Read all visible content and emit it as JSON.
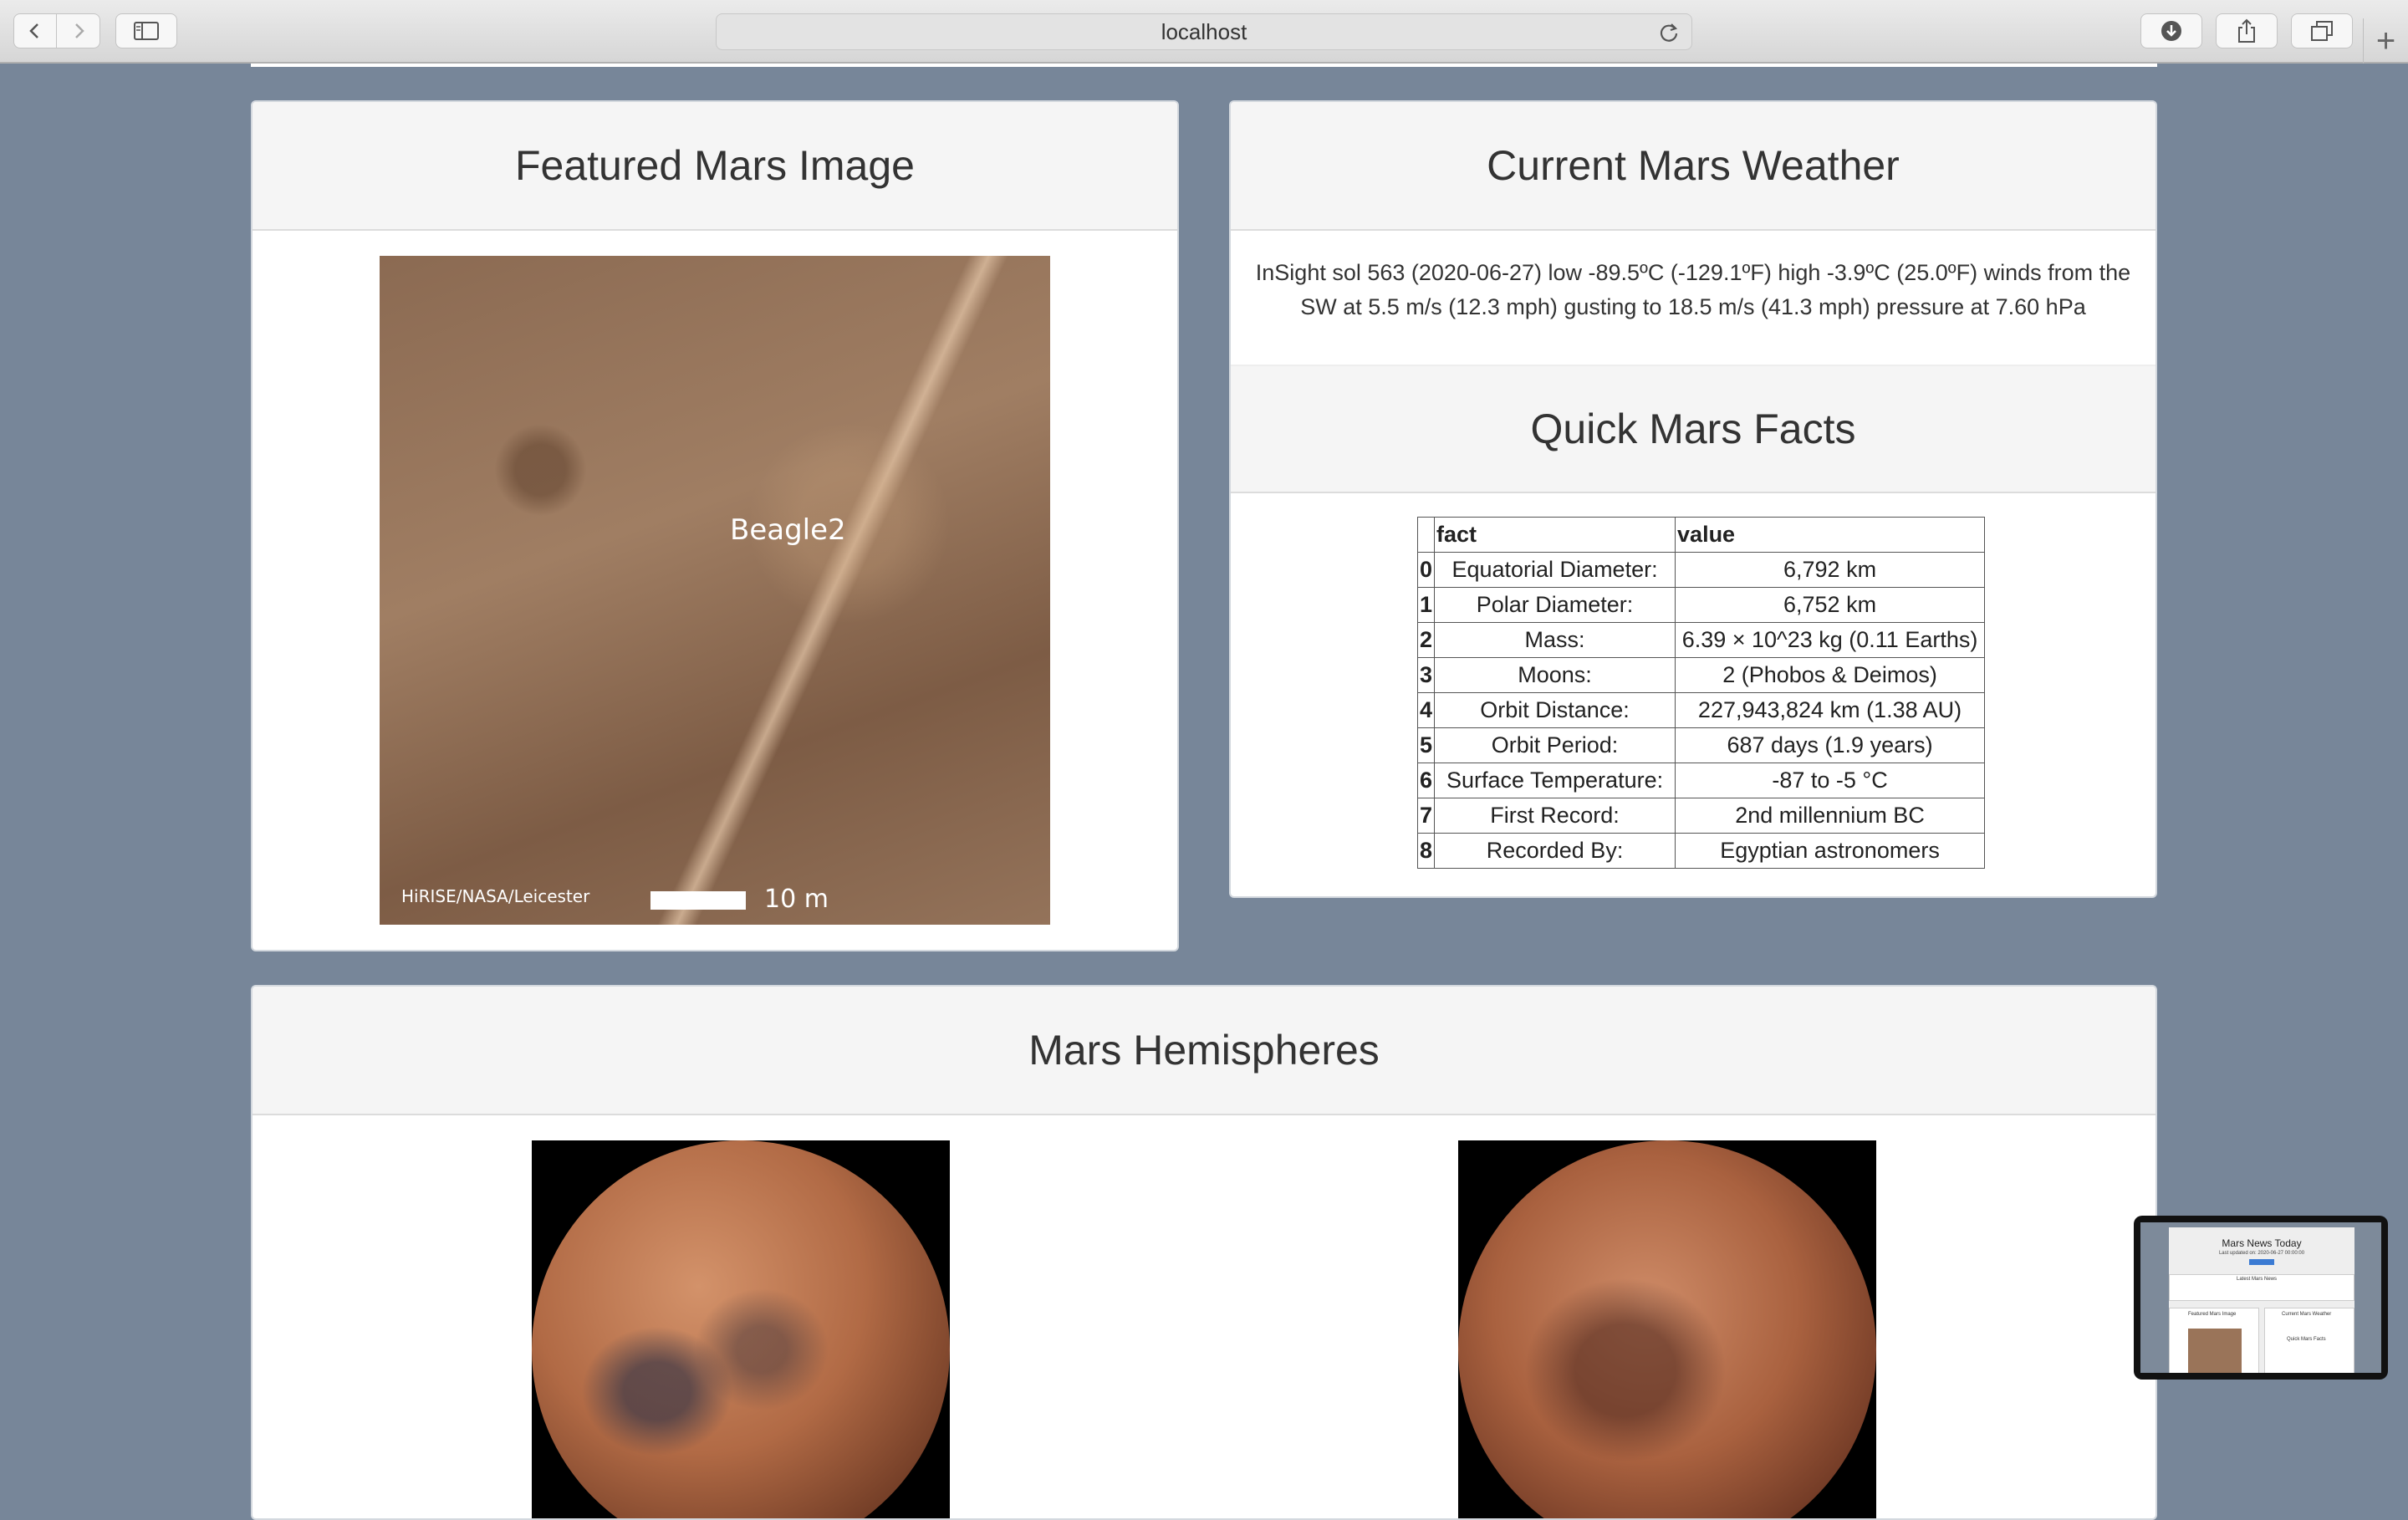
{
  "browser": {
    "url": "localhost",
    "icons": {
      "back": "chevron-left-icon",
      "forward": "chevron-right-icon",
      "sidebar": "sidebar-icon",
      "reload": "reload-icon",
      "downloads": "download-icon",
      "share": "share-icon",
      "tabs": "tabs-icon",
      "new_tab": "plus-icon"
    },
    "new_tab_label": "+"
  },
  "featured": {
    "title": "Featured Mars Image",
    "image_overlay": {
      "label": "Beagle2",
      "credit": "HiRISE/NASA/Leicester",
      "scale": "10 m"
    }
  },
  "weather": {
    "title": "Current Mars Weather",
    "text": "InSight sol 563 (2020-06-27) low -89.5ºC (-129.1ºF) high -3.9ºC (25.0ºF) winds from the SW at 5.5 m/s (12.3 mph) gusting to 18.5 m/s (41.3 mph) pressure at 7.60 hPa"
  },
  "facts": {
    "title": "Quick Mars Facts",
    "headers": [
      "",
      "fact",
      "value"
    ],
    "rows": [
      {
        "idx": "0",
        "fact": "Equatorial Diameter:",
        "value": "6,792 km"
      },
      {
        "idx": "1",
        "fact": "Polar Diameter:",
        "value": "6,752 km"
      },
      {
        "idx": "2",
        "fact": "Mass:",
        "value": "6.39 × 10^23 kg (0.11 Earths)"
      },
      {
        "idx": "3",
        "fact": "Moons:",
        "value": "2 (Phobos & Deimos)"
      },
      {
        "idx": "4",
        "fact": "Orbit Distance:",
        "value": "227,943,824 km (1.38 AU)"
      },
      {
        "idx": "5",
        "fact": "Orbit Period:",
        "value": "687 days (1.9 years)"
      },
      {
        "idx": "6",
        "fact": "Surface Temperature:",
        "value": "-87 to -5 °C"
      },
      {
        "idx": "7",
        "fact": "First Record:",
        "value": "2nd millennium BC"
      },
      {
        "idx": "8",
        "fact": "Recorded By:",
        "value": "Egyptian astronomers"
      }
    ]
  },
  "hemispheres": {
    "title": "Mars Hemispheres"
  },
  "thumbnail": {
    "title": "Mars News Today",
    "subtitle": "Last updated on: 2020-06-27 00:00:00",
    "section1": "Latest Mars News",
    "section2": "Featured Mars Image",
    "section3": "Current Mars Weather",
    "section4": "Quick Mars Facts"
  }
}
